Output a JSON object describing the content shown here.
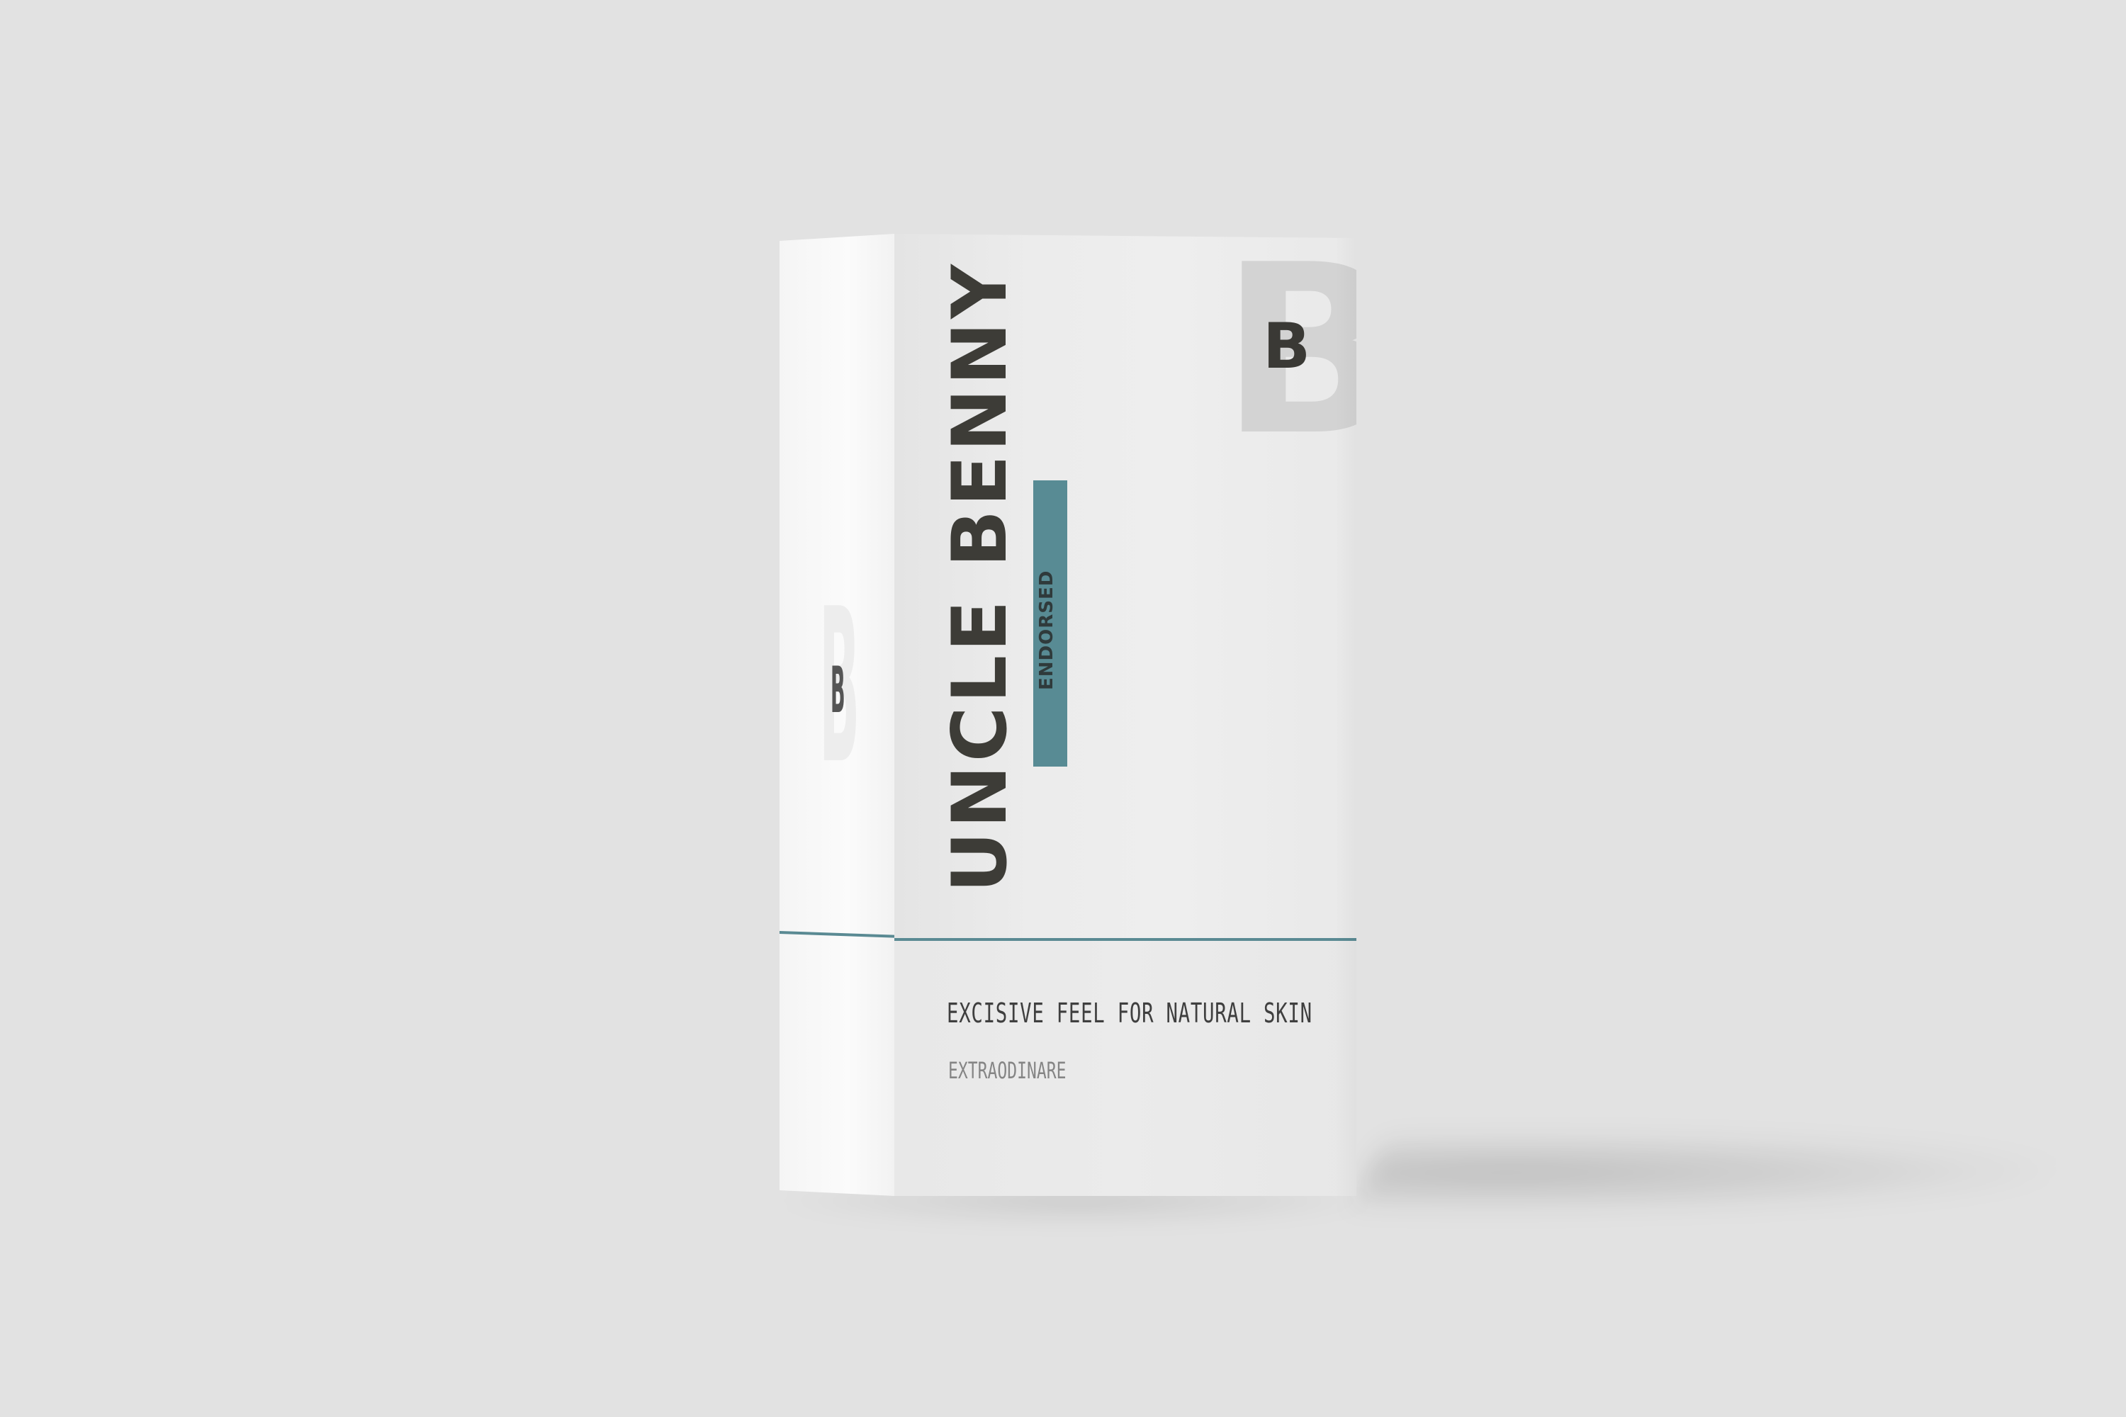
{
  "product": {
    "brand_name": "UNCLE BENNY",
    "endorsed_label": "ENDORSED",
    "monogram_large": "B",
    "monogram_small": "B",
    "side_monogram_large": "B",
    "side_monogram_small": "B",
    "tagline": "EXCISIVE FEEL FOR NATURAL SKIN",
    "subline": "EXTRAODINARE"
  },
  "colors": {
    "background": "#e2e2e2",
    "accent_teal": "#588b94",
    "text_dark": "#3d3c37",
    "monogram_light": "#d3d3d3"
  }
}
